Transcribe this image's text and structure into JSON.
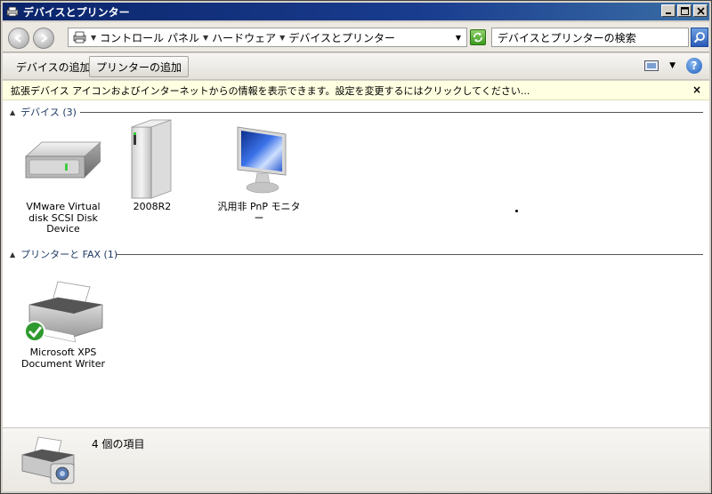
{
  "window": {
    "title": "デバイスとプリンター"
  },
  "address": {
    "crumbs": [
      "コントロール パネル",
      "ハードウェア",
      "デバイスとプリンター"
    ]
  },
  "search": {
    "placeholder": "デバイスとプリンターの検索"
  },
  "toolbar": {
    "add_device": "デバイスの追加",
    "add_printer": "プリンターの追加"
  },
  "infobar": {
    "text": "拡張デバイス アイコンおよびインターネットからの情報を表示できます。設定を変更するにはクリックしてください...",
    "close": "×"
  },
  "groups": {
    "devices": {
      "label": "デバイス (3)"
    },
    "printers": {
      "label": "プリンターと FAX (1)"
    }
  },
  "devices": [
    {
      "name": "VMware Virtual disk SCSI Disk Device",
      "icon": "hard-disk-icon"
    },
    {
      "name": "2008R2",
      "icon": "computer-tower-icon"
    },
    {
      "name": "汎用非 PnP モニター",
      "icon": "monitor-icon"
    }
  ],
  "printers": [
    {
      "name": "Microsoft XPS Document Writer",
      "icon": "printer-icon",
      "default": true
    }
  ],
  "details": {
    "count": "4 個の項目"
  },
  "colors": {
    "titlebar": "#0a246a",
    "infobar": "#ffffe1",
    "accent": "#1e3964"
  }
}
